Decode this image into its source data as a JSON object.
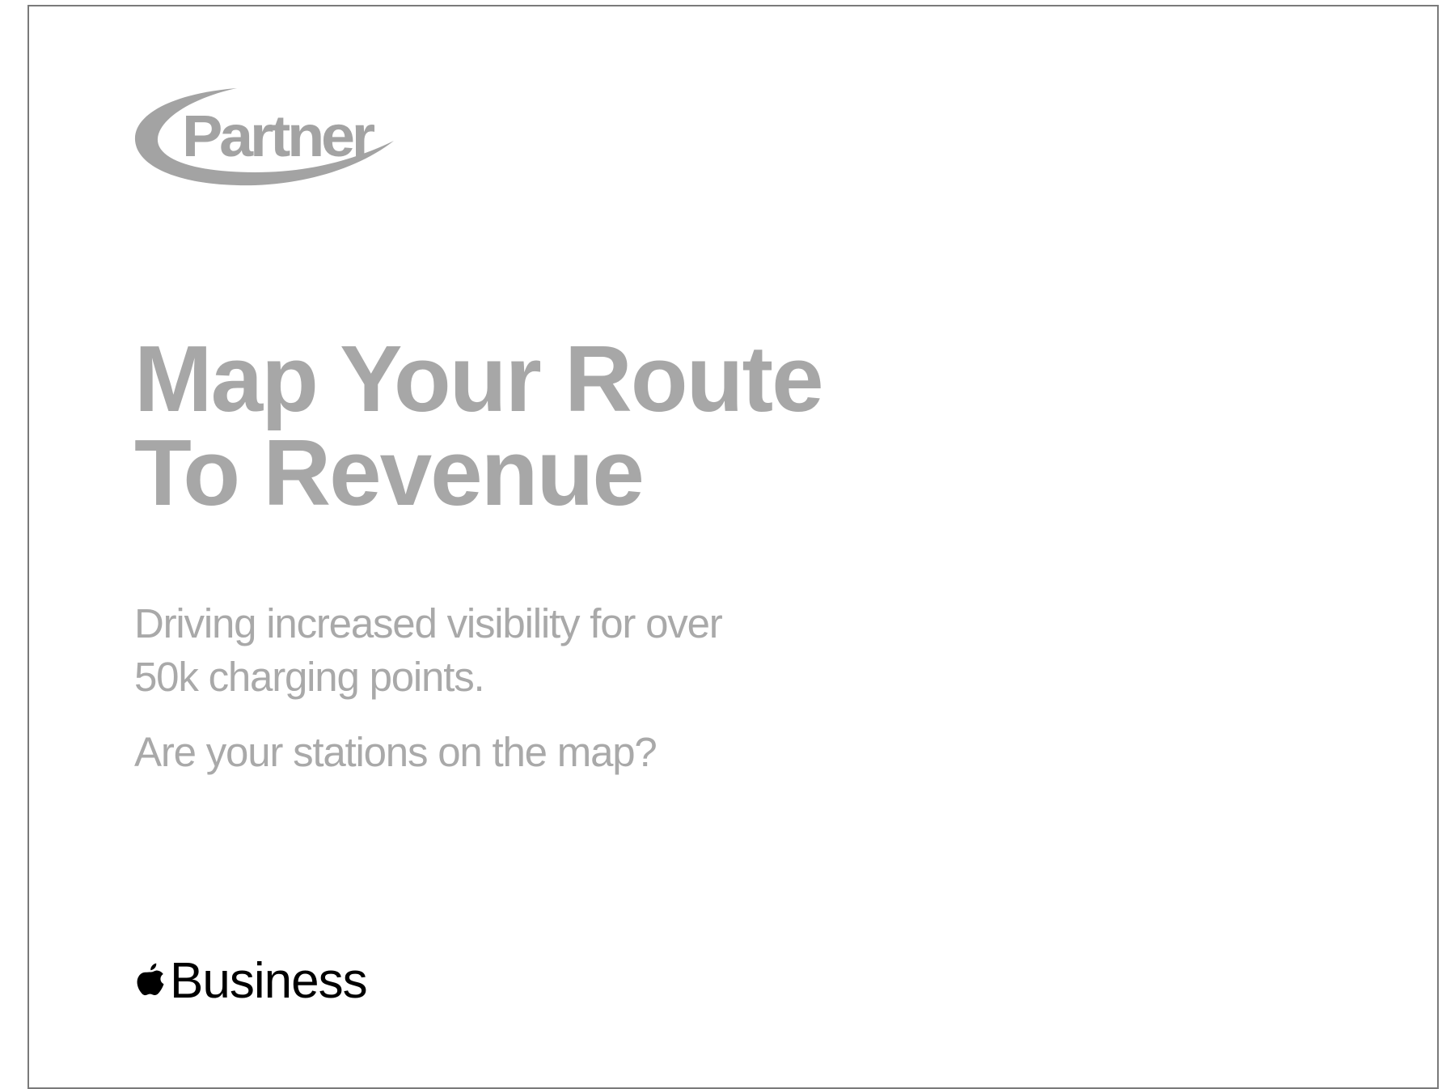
{
  "logo": {
    "text": "Partner",
    "color": "#a3a3a3"
  },
  "headline": {
    "line1": "Map Your Route",
    "line2": "To Revenue"
  },
  "subtext": {
    "line1": "Driving increased visibility for over",
    "line2": "50k charging points."
  },
  "question": "Are your stations on the map?",
  "brand": {
    "icon": "apple-logo-icon",
    "label": "Business"
  },
  "colors": {
    "headline": "#a7a7a7",
    "body_text": "#a9a9a9",
    "brand_text": "#000000",
    "border": "#7a7a7a"
  }
}
